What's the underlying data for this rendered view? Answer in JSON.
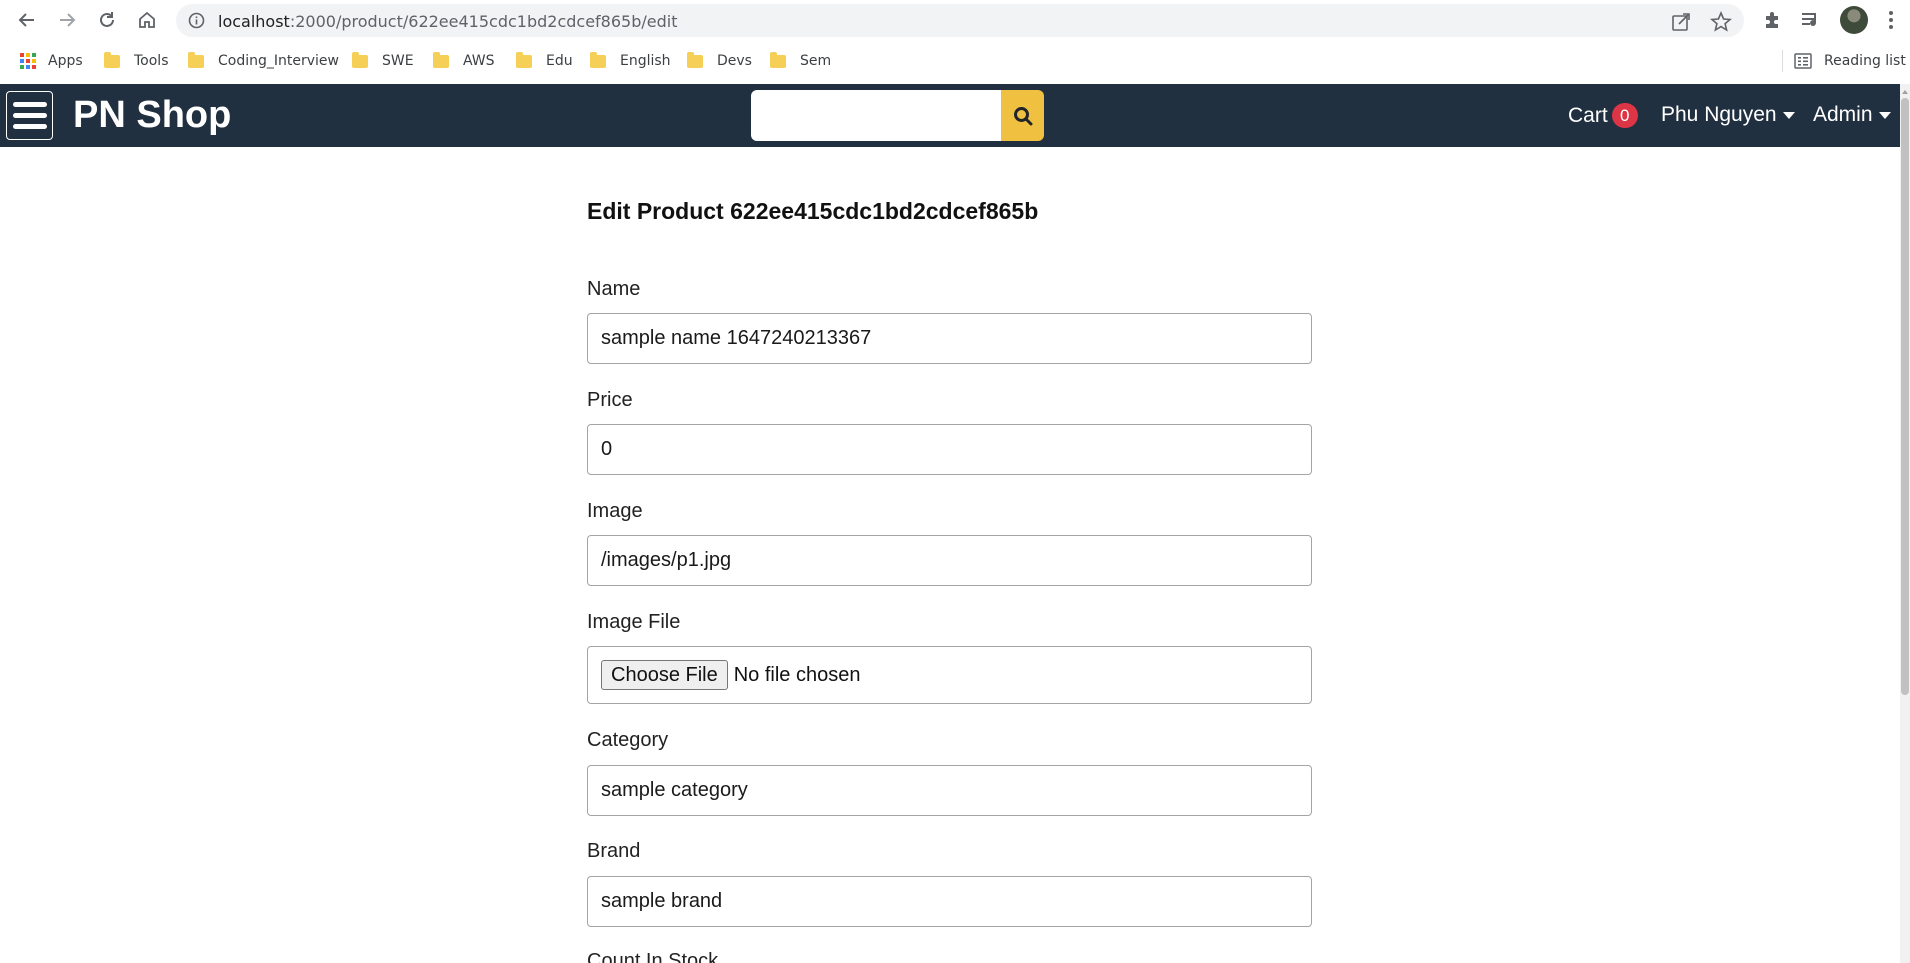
{
  "browser": {
    "url_host": "localhost",
    "url_path": ":2000/product/622ee415cdc1bd2cdcef865b/edit",
    "bookmarks": [
      {
        "label": "Apps",
        "icon": "apps-grid-icon"
      },
      {
        "label": "Tools",
        "icon": "folder-icon"
      },
      {
        "label": "Coding_Interview",
        "icon": "folder-icon"
      },
      {
        "label": "SWE",
        "icon": "folder-icon"
      },
      {
        "label": "AWS",
        "icon": "folder-icon"
      },
      {
        "label": "Edu",
        "icon": "folder-icon"
      },
      {
        "label": "English",
        "icon": "folder-icon"
      },
      {
        "label": "Devs",
        "icon": "folder-icon"
      },
      {
        "label": "Sem",
        "icon": "folder-icon"
      }
    ],
    "reading_list": "Reading list"
  },
  "navbar": {
    "brand": "PN Shop",
    "search_placeholder": "",
    "cart_label": "Cart",
    "cart_count": "0",
    "user_name": "Phu Nguyen",
    "admin_label": "Admin",
    "background": "#203040",
    "accent": "#f0c040",
    "badge_color": "#dc3545"
  },
  "form": {
    "title": "Edit Product 622ee415cdc1bd2cdcef865b",
    "fields": [
      {
        "label": "Name",
        "value": "sample name 1647240213367"
      },
      {
        "label": "Price",
        "value": "0"
      },
      {
        "label": "Image",
        "value": "/images/p1.jpg"
      },
      {
        "label": "Category",
        "value": "sample category"
      },
      {
        "label": "Brand",
        "value": "sample brand"
      }
    ],
    "image_file": {
      "label": "Image File",
      "button": "Choose File",
      "status": "No file chosen"
    },
    "count_in_stock_label": "Count In Stock"
  }
}
